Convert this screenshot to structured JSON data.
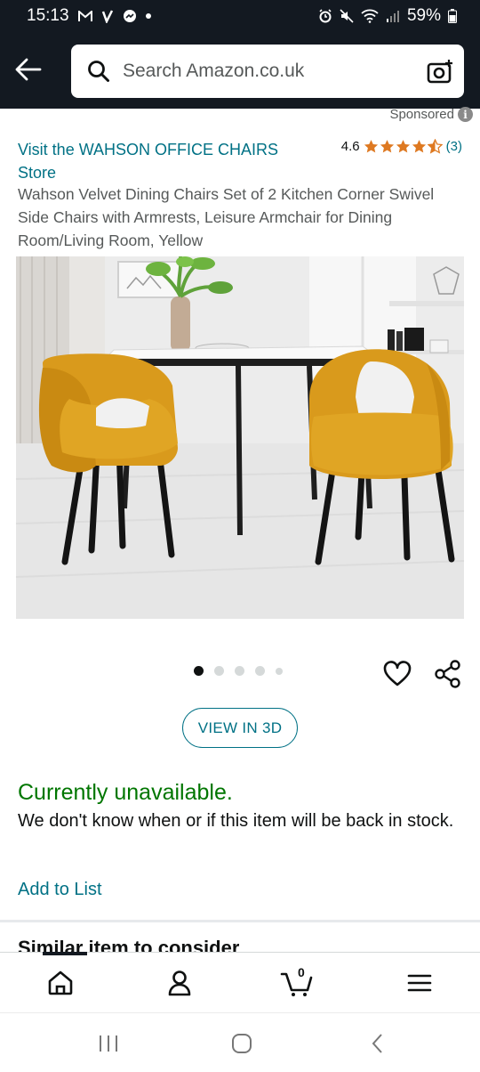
{
  "status_bar": {
    "time": "15:13",
    "battery": "59%"
  },
  "header": {
    "search_placeholder": "Search Amazon.co.uk"
  },
  "sponsored": {
    "label": "Sponsored"
  },
  "product": {
    "store_link": "Visit the WAHSON OFFICE CHAIRS Store",
    "rating_value": "4.6",
    "rating_stars": 4.6,
    "rating_count": "(3)",
    "title": "Wahson Velvet Dining Chairs Set of 2 Kitchen Corner Swivel Side Chairs with Armrests, Leisure Armchair for Dining Room/Living Room, Yellow",
    "image_count": 5,
    "image_active_index": 0
  },
  "actions": {
    "view_3d": "VIEW IN 3D"
  },
  "availability": {
    "status": "Currently unavailable.",
    "detail": "We don't know when or if this item will be back in stock.",
    "add_to_list": "Add to List"
  },
  "similar": {
    "heading": "Similar item to consider"
  },
  "bottom_nav": {
    "cart_count": "0"
  },
  "colors": {
    "header_bg": "#131921",
    "link": "#007185",
    "star": "#de7921",
    "available_green": "#007600",
    "chair_yellow": "#d99a1c"
  }
}
